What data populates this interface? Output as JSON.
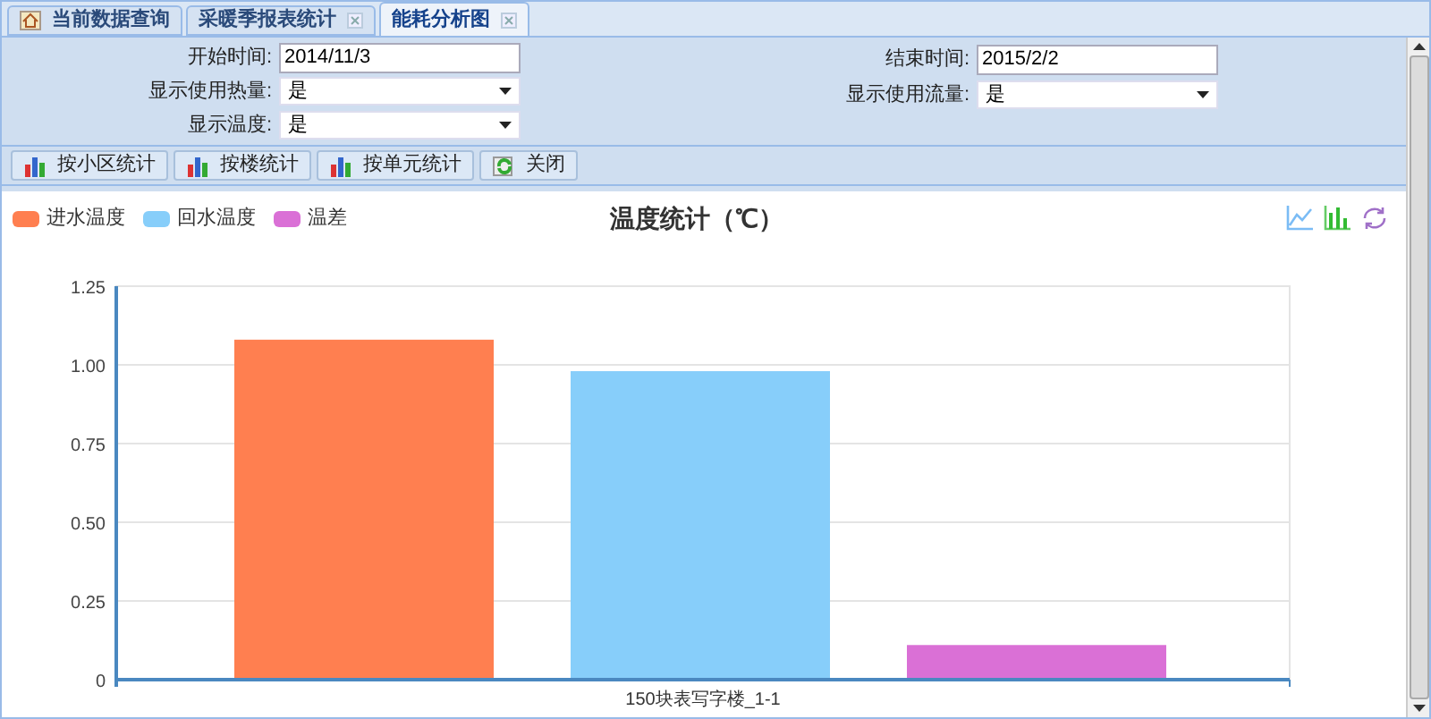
{
  "tabs": [
    {
      "label": "当前数据查询",
      "selected": false,
      "closable": false,
      "icon": true
    },
    {
      "label": "采暖季报表统计",
      "selected": false,
      "closable": true,
      "icon": false
    },
    {
      "label": "能耗分析图",
      "selected": true,
      "closable": true,
      "icon": false
    }
  ],
  "form": {
    "left": [
      {
        "kind": "text",
        "label": "开始时间:",
        "value": "2014/11/3"
      },
      {
        "kind": "select",
        "label": "显示使用热量:",
        "value": "是"
      },
      {
        "kind": "select",
        "label": "显示温度:",
        "value": "是"
      }
    ],
    "right": [
      {
        "kind": "text",
        "label": "结束时间:",
        "value": "2015/2/2"
      },
      {
        "kind": "select",
        "label": "显示使用流量:",
        "value": "是"
      }
    ]
  },
  "toolbar": [
    {
      "kind": "chart",
      "label": "按小区统计"
    },
    {
      "kind": "chart",
      "label": "按楼统计"
    },
    {
      "kind": "chart",
      "label": "按单元统计"
    },
    {
      "kind": "refresh",
      "label": "关闭"
    }
  ],
  "chart": {
    "chart_data": {
      "type": "bar",
      "title": "温度统计（℃）",
      "categories": [
        "150块表写字楼_1-1"
      ],
      "series": [
        {
          "name": "进水温度",
          "color": "#ff7f50",
          "values": [
            1.08
          ]
        },
        {
          "name": "回水温度",
          "color": "#87cefa",
          "values": [
            0.98
          ]
        },
        {
          "name": "温差",
          "color": "#da70d6",
          "values": [
            0.11
          ]
        }
      ],
      "grid": true,
      "legend": true,
      "ylim": [
        0,
        1.25
      ],
      "yticks": [
        {
          "value": 0,
          "label": "0"
        },
        {
          "value": 0.25,
          "label": "0.25"
        },
        {
          "value": 0.5,
          "label": "0.50"
        },
        {
          "value": 0.75,
          "label": "0.75"
        },
        {
          "value": 1,
          "label": "1.00"
        },
        {
          "value": 1.25,
          "label": "1.25"
        }
      ]
    }
  }
}
